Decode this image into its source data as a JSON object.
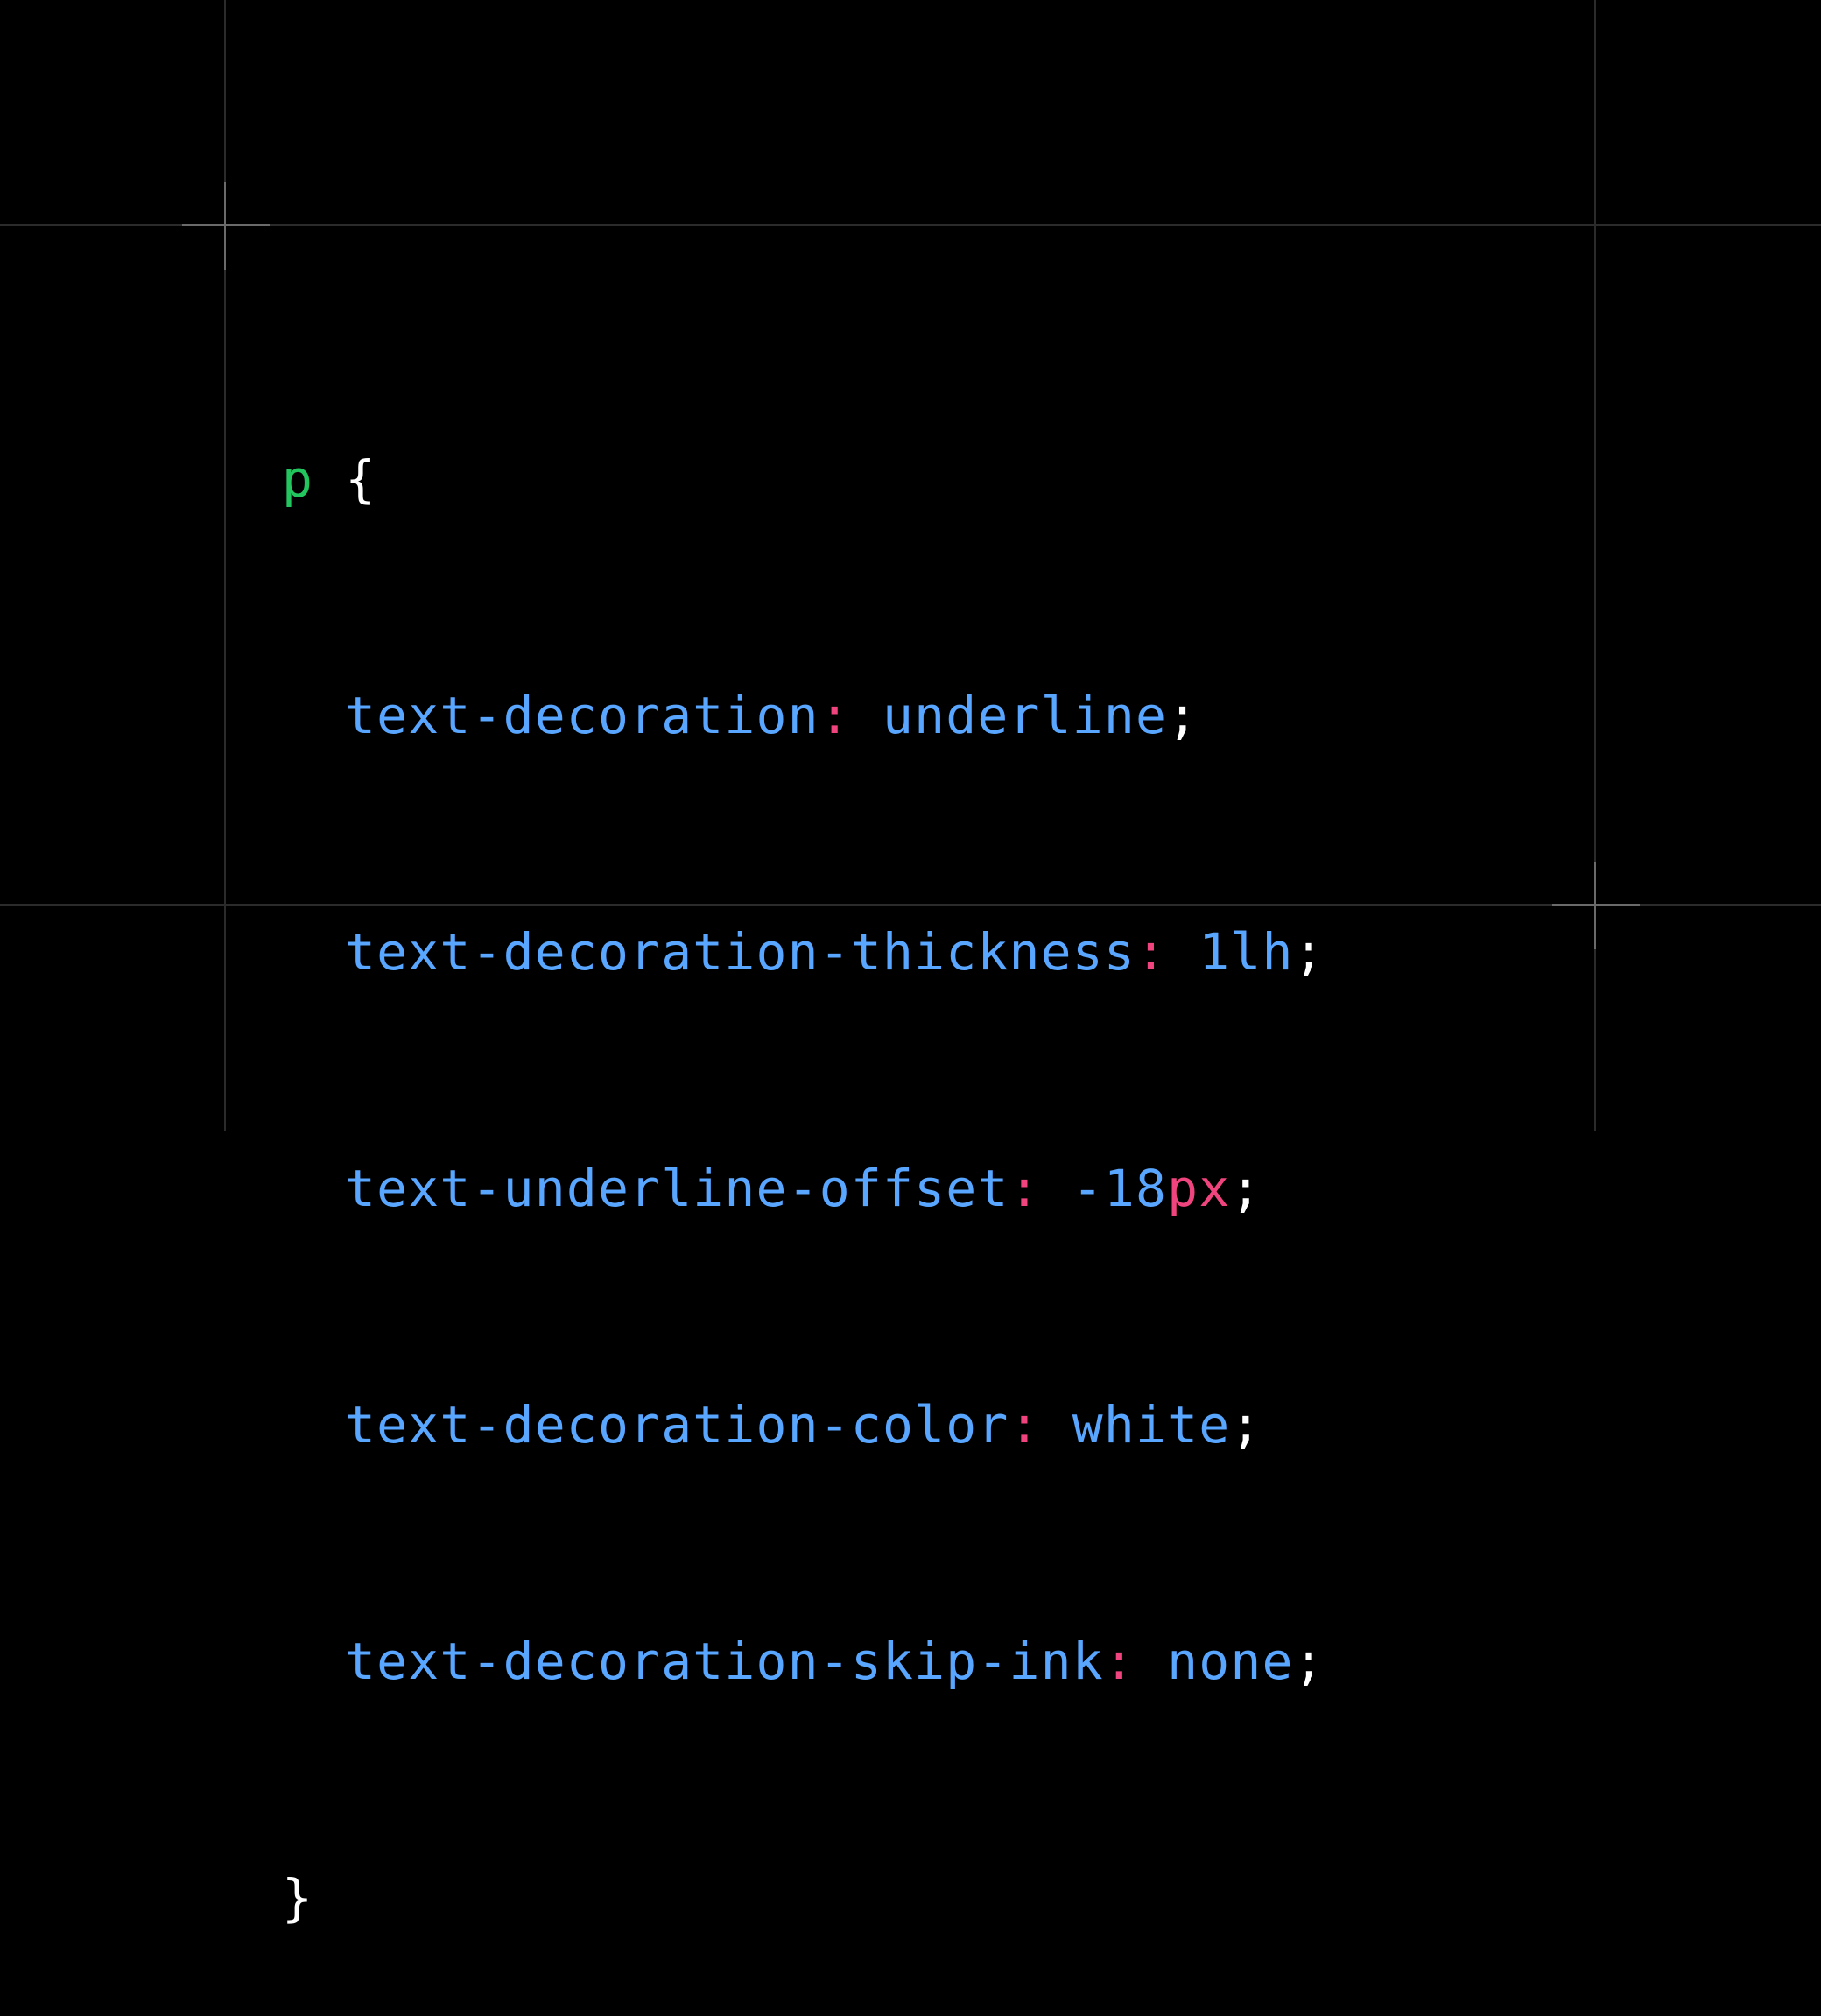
{
  "code": {
    "selector": "p",
    "open_brace": "{",
    "close_brace": "}",
    "declarations": [
      {
        "property": "text-decoration",
        "value": "underline",
        "unit": ""
      },
      {
        "property": "text-decoration-thickness",
        "value": "1lh",
        "unit": ""
      },
      {
        "property": "text-underline-offset",
        "value": "-18",
        "unit": "px"
      },
      {
        "property": "text-decoration-color",
        "value": "white",
        "unit": ""
      },
      {
        "property": "text-decoration-skip-ink",
        "value": "none",
        "unit": ""
      }
    ],
    "colon": ":",
    "semicolon": ";"
  },
  "colors": {
    "background": "#000000",
    "selector": "#22c55e",
    "property": "#58a6ff",
    "value": "#58a6ff",
    "colon": "#f0447e",
    "unit": "#f0447e",
    "punctuation": "#ffffff",
    "guide": "#2b2b2b",
    "corner_mark": "#6a6a6a"
  }
}
